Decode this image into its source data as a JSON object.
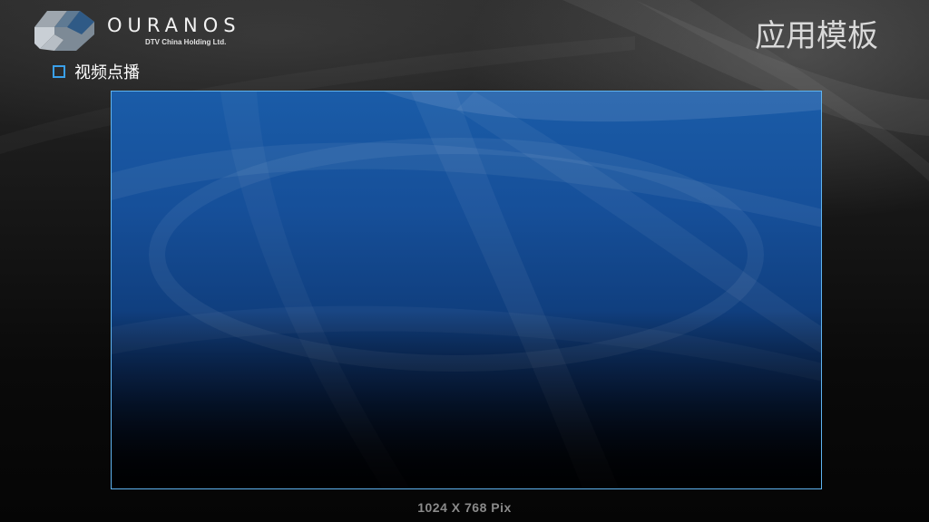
{
  "brand": {
    "name": "OURANOS",
    "subtitle": "DTV China Holding Ltd.",
    "logo_icon": "cube-logo-icon"
  },
  "header": {
    "title": "应用模板"
  },
  "section": {
    "label": "视频点播",
    "icon": "square-bullet-icon"
  },
  "preview": {
    "resolution_label": "1024 X 768 Pix"
  },
  "colors": {
    "accent": "#3aa0ea",
    "frame_border": "#5fb4f0",
    "preview_top": "#1a5ca8",
    "preview_bottom": "#01030a",
    "background": "#1b1b1b"
  }
}
